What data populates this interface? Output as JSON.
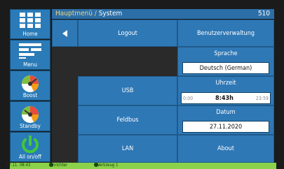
{
  "header": {
    "breadcrumb_main": "Hauptmenü",
    "breadcrumb_sep": "/",
    "breadcrumb_current": "System",
    "station_id": "510"
  },
  "sidebar": {
    "items": [
      {
        "label": "Home",
        "icon": "grid-icon"
      },
      {
        "label": "Menu",
        "icon": "menu-list-icon"
      },
      {
        "label": "Boost",
        "icon": "boost-gauge-icon"
      },
      {
        "label": "Standby",
        "icon": "standby-gauge-icon"
      },
      {
        "label": "All on/off",
        "icon": "power-icon"
      }
    ]
  },
  "buttons": {
    "back_icon": "back-triangle-icon",
    "logout": "Logout",
    "user_admin": "Benutzerverwaltung",
    "usb": "USB",
    "fieldbus": "Feldbus",
    "lan": "LAN",
    "about": "About"
  },
  "language": {
    "title": "Sprache",
    "value": "Deutsch (German)"
  },
  "time": {
    "title": "Uhrzeit",
    "min": "0:00",
    "value": "8:43h",
    "max": "23:59"
  },
  "date": {
    "title": "Datum",
    "value": "27.11.2020"
  },
  "status_bar": {
    "timestamp": "27.11. 08:43",
    "setup_label": "Einrichter",
    "tool_label": "*Werkzeug 1"
  },
  "colors": {
    "accent": "#2f78b6",
    "status": "#8bd14a",
    "header_highlight": "#f4d47a"
  }
}
